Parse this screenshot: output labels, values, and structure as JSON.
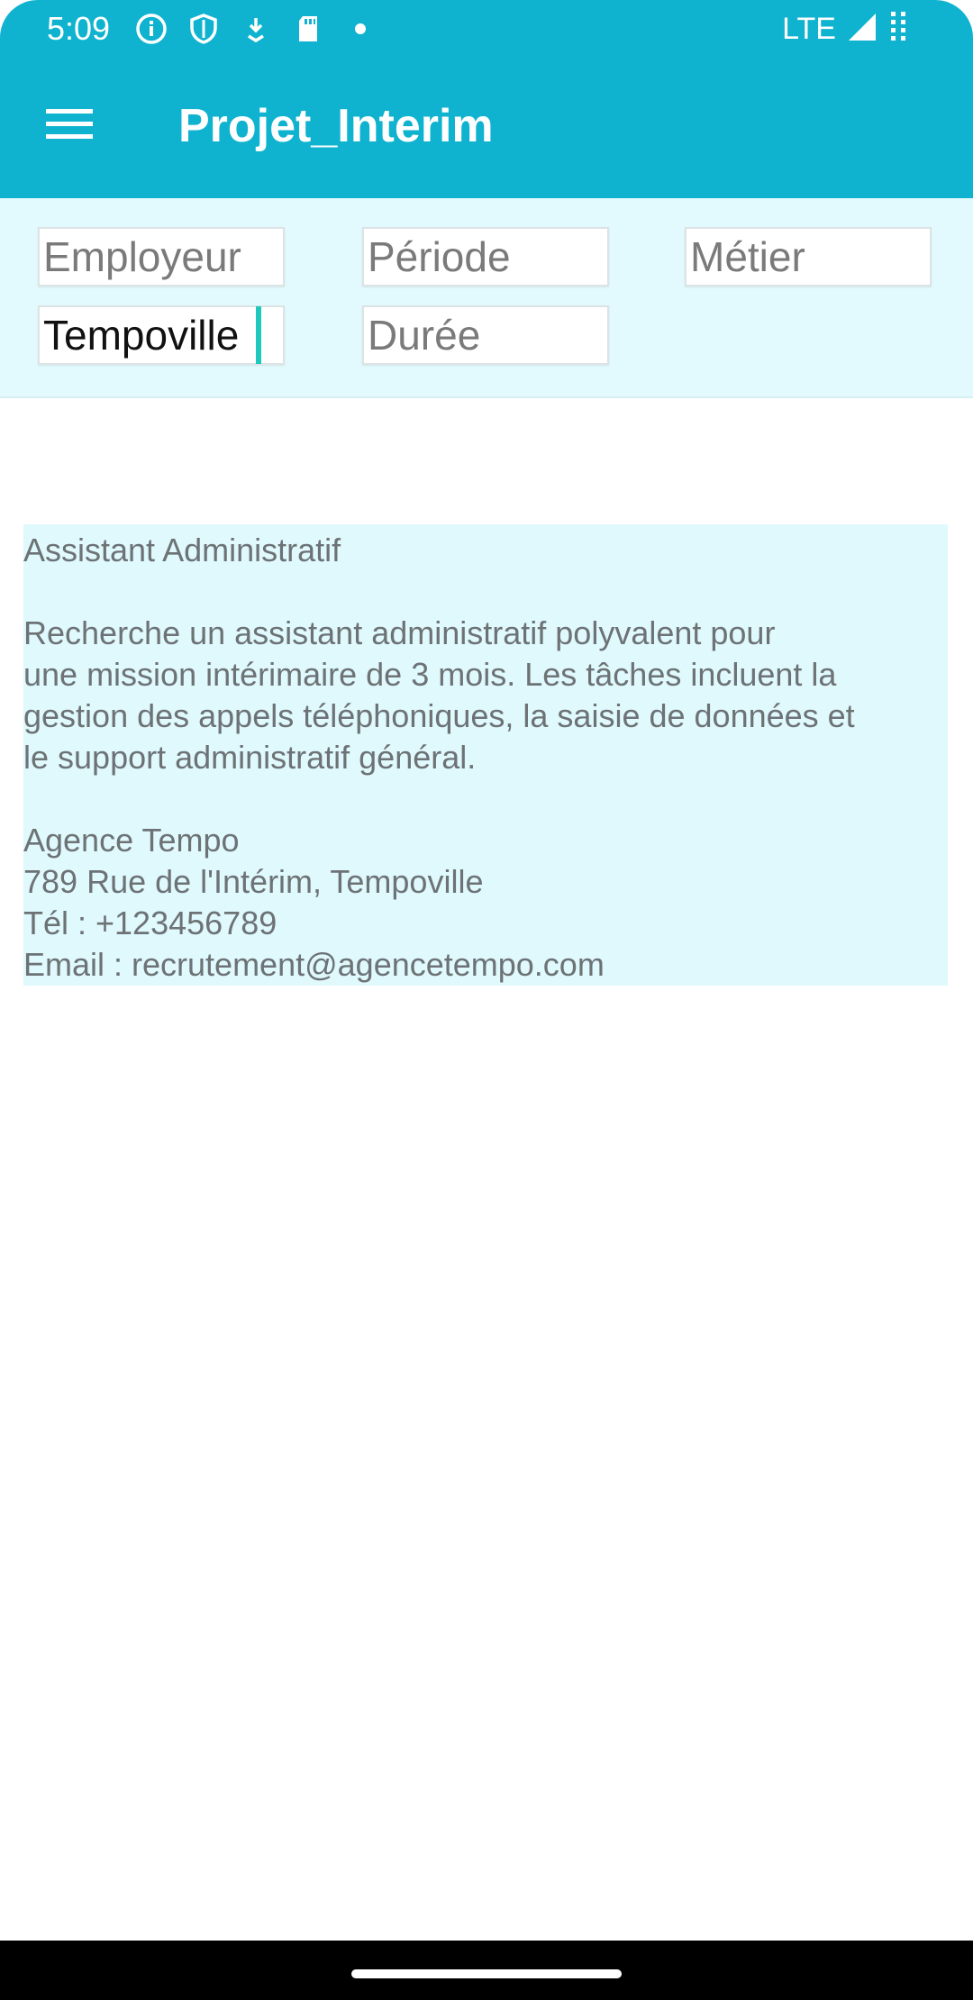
{
  "status_bar": {
    "time": "5:09",
    "network": "LTE",
    "icons": [
      "info-icon",
      "shield-icon",
      "download-icon",
      "sd-card-icon",
      "dot-icon",
      "signal-icon",
      "battery-icon"
    ]
  },
  "app_bar": {
    "title": "Projet_Interim",
    "menu_icon": "hamburger-menu-icon"
  },
  "filters": {
    "employeur": {
      "placeholder": "Employeur",
      "value": ""
    },
    "periode": {
      "placeholder": "Période",
      "value": ""
    },
    "metier": {
      "placeholder": "Métier",
      "value": ""
    },
    "lieu": {
      "placeholder": "",
      "value": "Tempoville"
    },
    "duree": {
      "placeholder": "Durée",
      "value": ""
    }
  },
  "offer": {
    "title": "Assistant Administratif",
    "description_lines": [
      "Recherche un assistant administratif polyvalent pour",
      "une mission intérimaire de 3 mois. Les tâches incluent la",
      "gestion des appels téléphoniques, la saisie de données et",
      "le support administratif général."
    ],
    "agency": "Agence Tempo",
    "address": "789 Rue de l'Intérim, Tempoville",
    "phone": "Tél : +123456789",
    "email": "Email : recrutement@agencetempo.com"
  },
  "colors": {
    "primary": "#0fb3cf",
    "filter_bg": "#e2fafd",
    "card_bg": "#dff9fd",
    "caret": "#1ec8bd"
  }
}
